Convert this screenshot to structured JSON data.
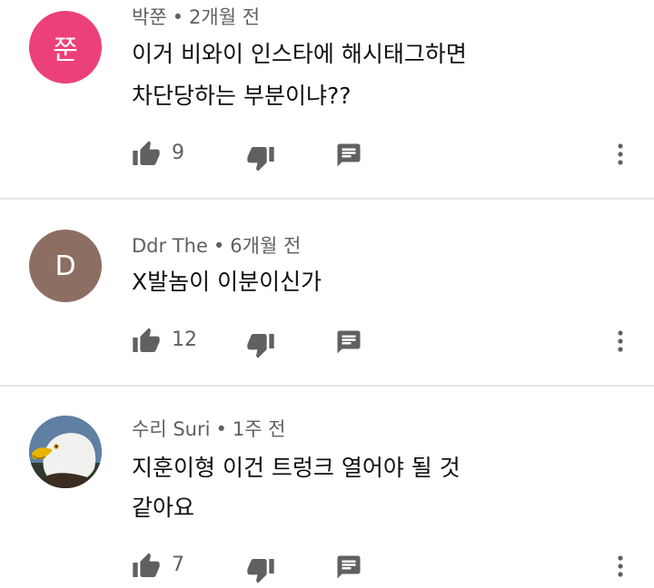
{
  "comments": [
    {
      "avatar_initial": "쭌",
      "avatar_color": "#ec407a",
      "author": "박쭌",
      "separator": "•",
      "time": "2개월 전",
      "line1": "이거 비와이 인스타에 해시태그하면",
      "line2": "차단당하는 부분이냐??",
      "likes": "9"
    },
    {
      "avatar_initial": "D",
      "avatar_color": "#8d6e63",
      "author": "Ddr The",
      "separator": "•",
      "time": "6개월 전",
      "line1": "X발놈이 이분이신가",
      "line2": "",
      "likes": "12"
    },
    {
      "avatar_image": "bald-eagle-photo",
      "author": "수리 Suri",
      "separator": "•",
      "time": "1주 전",
      "line1": "지훈이형 이건 트렁크 열어야 될 것",
      "line2": "같아요",
      "likes": "7"
    }
  ],
  "icons": {
    "like": "thumb-up-icon",
    "dislike": "thumb-down-icon",
    "reply": "reply-comment-icon",
    "more": "more-vert-icon"
  }
}
